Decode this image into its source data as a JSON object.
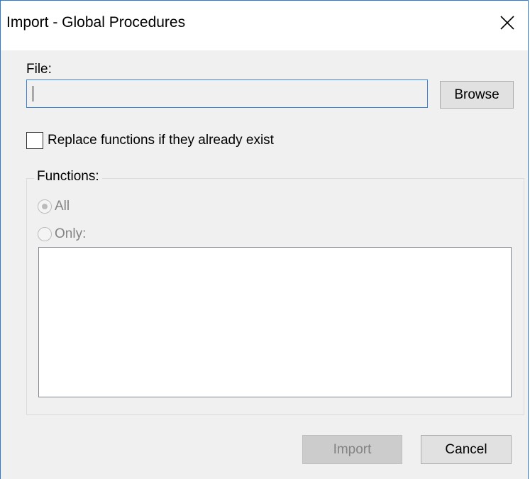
{
  "window": {
    "title": "Import - Global Procedures"
  },
  "file": {
    "label": "File:",
    "value": "",
    "browse_label": "Browse"
  },
  "options": {
    "replace_label": "Replace functions if they already exist",
    "replace_checked": false
  },
  "functions": {
    "group_label": "Functions:",
    "all_label": "All",
    "only_label": "Only:",
    "selected": "All",
    "list_items": []
  },
  "footer": {
    "import_label": "Import",
    "cancel_label": "Cancel"
  },
  "colors": {
    "accent": "#2b79d6",
    "dialog_bg": "#f0f0f0",
    "disabled_text": "#838383"
  },
  "icons": {
    "close": "close-icon"
  }
}
